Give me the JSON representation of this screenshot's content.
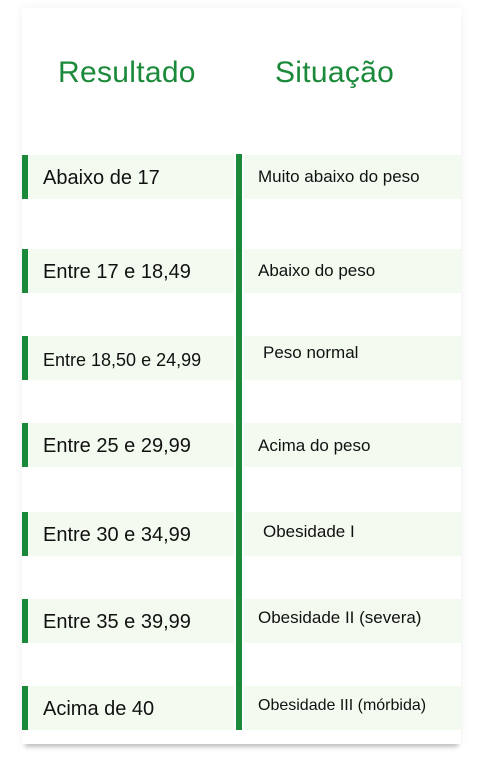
{
  "table": {
    "headers": {
      "result": "Resultado",
      "situation": "Situação"
    },
    "rows": [
      {
        "result": "Abaixo de 17",
        "situation": "Muito abaixo do peso"
      },
      {
        "result": "Entre 17 e 18,49",
        "situation": "Abaixo do peso"
      },
      {
        "result": "Entre 18,50 e 24,99",
        "situation": "Peso normal"
      },
      {
        "result": "Entre 25 e 29,99",
        "situation": "Acima do peso"
      },
      {
        "result": "Entre 30 e 34,99",
        "situation": "Obesidade I"
      },
      {
        "result": "Entre 35 e 39,99",
        "situation": "Obesidade II (severa)"
      },
      {
        "result": "Acima de 40",
        "situation": "Obesidade III (mórbida)"
      }
    ]
  },
  "colors": {
    "accent": "#1a8a3a",
    "row_background": "#f3fbf0",
    "text": "#111111"
  }
}
